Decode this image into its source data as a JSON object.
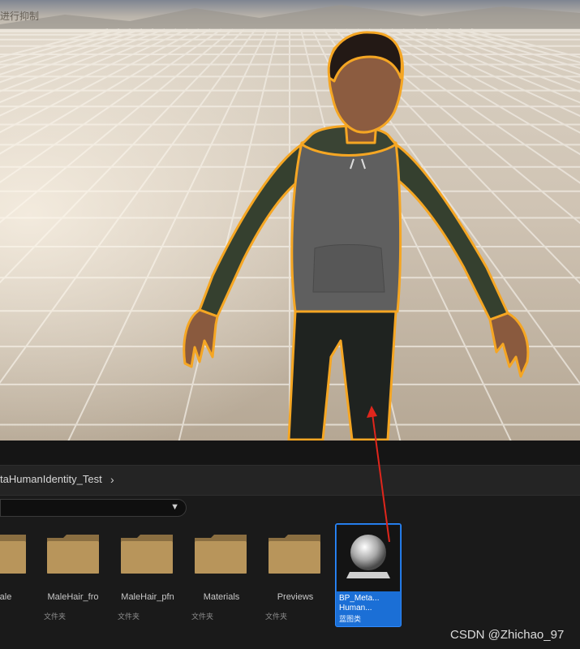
{
  "viewport": {
    "hint_text": "进行抑制"
  },
  "content_browser": {
    "path_label": "taHumanIdentity_Test",
    "items": [
      {
        "name": "ale",
        "type": "",
        "icon": "folder-icon"
      },
      {
        "name": "MaleHair_fro",
        "type": "文件夹",
        "icon": "folder-icon"
      },
      {
        "name": "MaleHair_pfn",
        "type": "文件夹",
        "icon": "folder-icon"
      },
      {
        "name": "Materials",
        "type": "文件夹",
        "icon": "folder-icon"
      },
      {
        "name": "Previews",
        "type": "文件夹",
        "icon": "folder-icon"
      }
    ],
    "selected_asset": {
      "name_line1": "BP_Meta...",
      "name_line2": "Human...",
      "type": "蓝图类",
      "icon": "blueprint-sphere-icon"
    }
  },
  "colors": {
    "selection_outline": "#f5a623",
    "selected_tile": "#1b6fd6",
    "annotation_arrow": "#e0261c"
  },
  "watermark": "CSDN @Zhichao_97"
}
